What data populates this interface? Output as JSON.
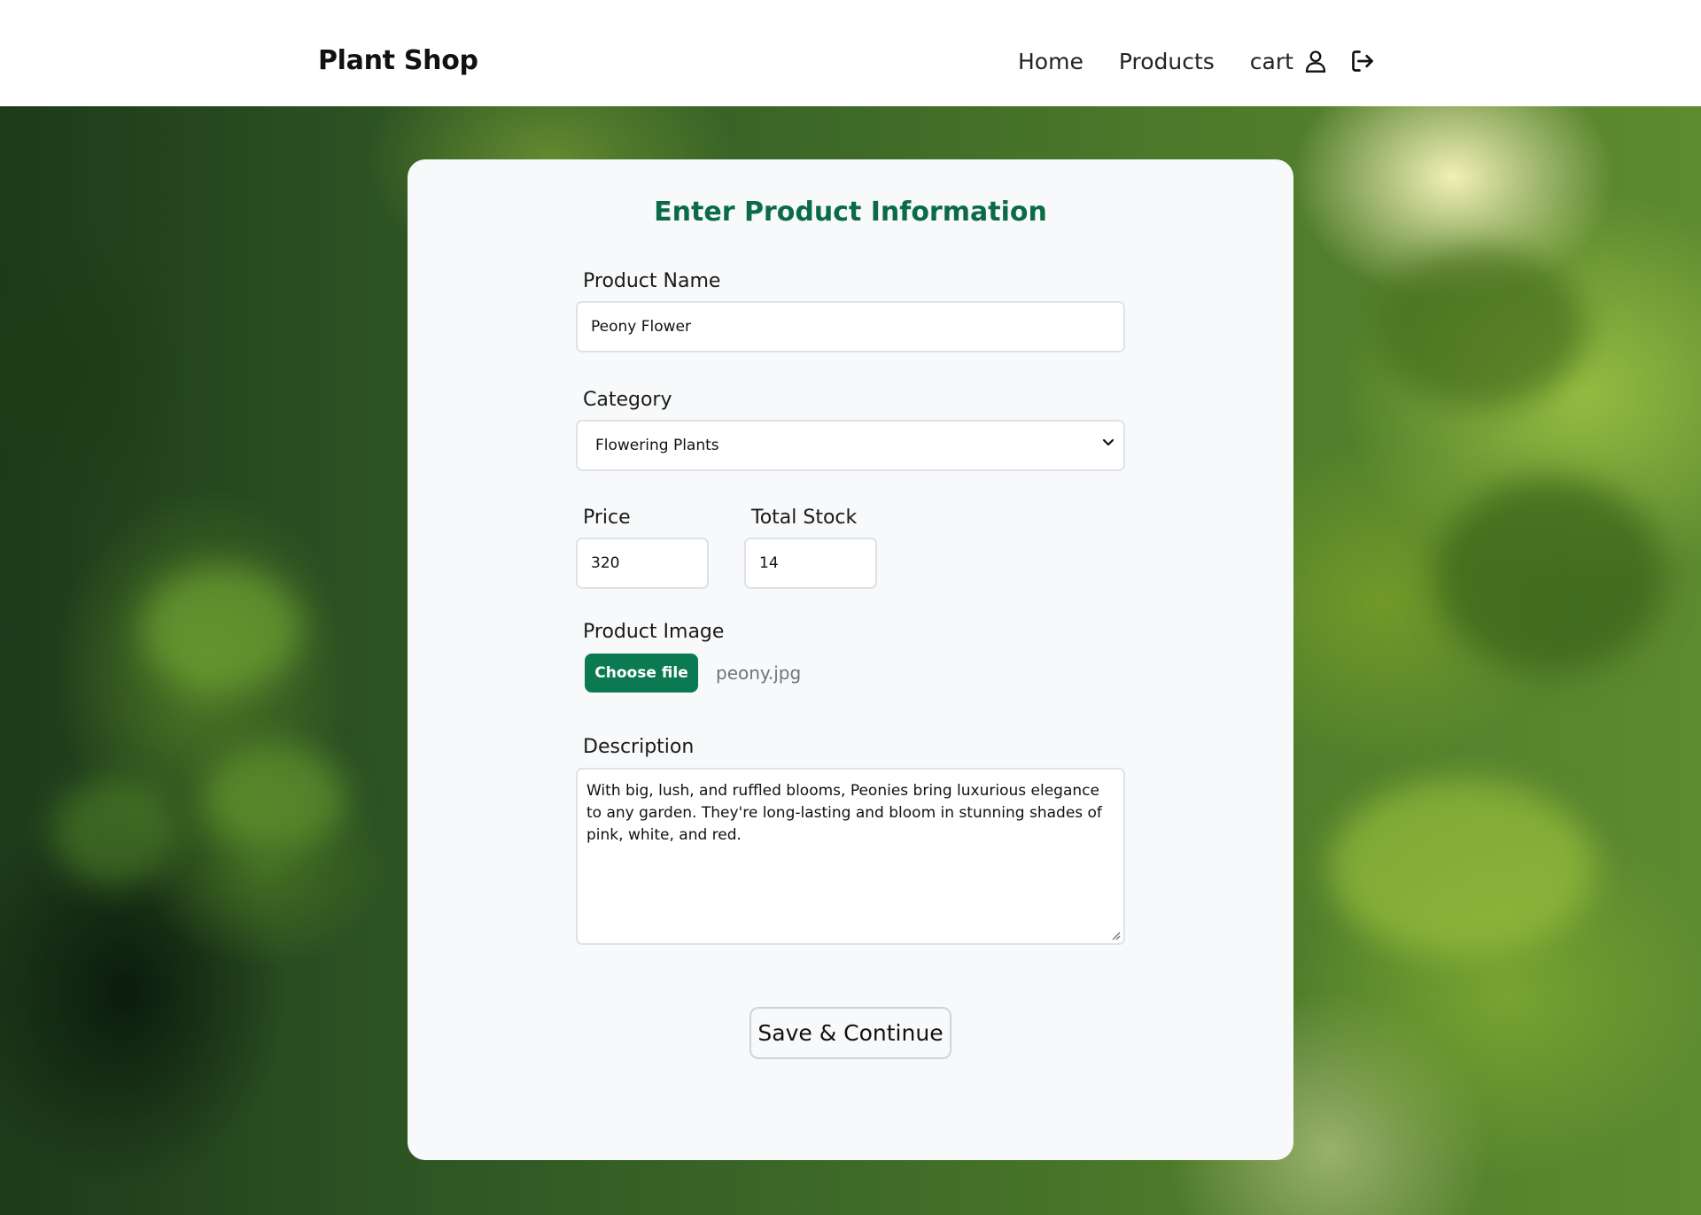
{
  "navbar": {
    "brand": "Plant Shop",
    "links": [
      "Home",
      "Products",
      "cart"
    ],
    "icons": [
      "user-icon",
      "logout-icon"
    ]
  },
  "form": {
    "title": "Enter Product Information",
    "product_name": {
      "label": "Product Name",
      "value": "Peony Flower"
    },
    "category": {
      "label": "Category",
      "selected": "Flowering Plants"
    },
    "price": {
      "label": "Price",
      "value": "320"
    },
    "stock": {
      "label": "Total Stock",
      "value": "14"
    },
    "image": {
      "label": "Product Image",
      "button": "Choose file",
      "file_name": "peony.jpg"
    },
    "description": {
      "label": "Description",
      "value": "With big, lush, and ruffled blooms, Peonies bring luxurious elegance to any garden. They're long-lasting and bloom in stunning shades of pink, white, and red."
    },
    "submit": "Save & Continue"
  },
  "colors": {
    "accent": "#0b7a52",
    "title": "#0b6b47",
    "card": "#f8f9fa"
  }
}
